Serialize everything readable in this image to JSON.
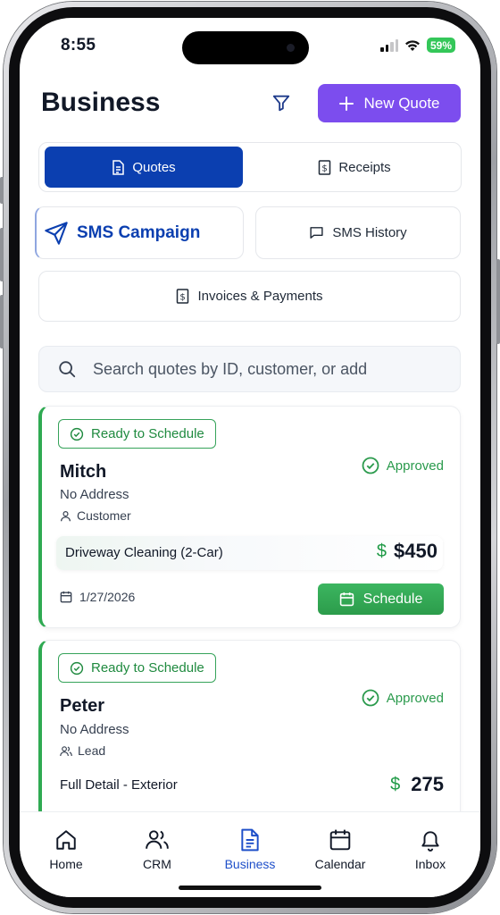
{
  "status_bar": {
    "time": "8:55",
    "battery": "59%"
  },
  "header": {
    "title": "Business",
    "new_quote_label": "New Quote"
  },
  "tabs": [
    {
      "label": "Quotes",
      "active": true
    },
    {
      "label": "Receipts",
      "active": false
    }
  ],
  "actions": {
    "sms_campaign": "SMS Campaign",
    "sms_history": "SMS History",
    "invoices": "Invoices & Payments"
  },
  "search": {
    "placeholder": "Search quotes by ID, customer, or add"
  },
  "quotes": [
    {
      "badge": "Ready to Schedule",
      "status": "Approved",
      "name": "Mitch",
      "address": "No Address",
      "type": "Customer",
      "service": "Driveway Cleaning (2-Car)",
      "currency": "$",
      "amount": "$450",
      "date": "1/27/2026",
      "action": "Schedule"
    },
    {
      "badge": "Ready to Schedule",
      "status": "Approved",
      "name": "Peter",
      "address": "No Address",
      "type": "Lead",
      "service": "Full Detail - Exterior",
      "currency": "$",
      "amount": "275"
    }
  ],
  "nav": [
    {
      "label": "Home",
      "icon": "home-icon",
      "active": false
    },
    {
      "label": "CRM",
      "icon": "users-icon",
      "active": false
    },
    {
      "label": "Business",
      "icon": "document-icon",
      "active": true
    },
    {
      "label": "Calendar",
      "icon": "calendar-icon",
      "active": false
    },
    {
      "label": "Inbox",
      "icon": "bell-icon",
      "active": false
    }
  ],
  "colors": {
    "primary": "#0b3fb0",
    "accent_purple": "#7c4dee",
    "success_green": "#2faa52",
    "nav_active": "#1e4fc9"
  }
}
